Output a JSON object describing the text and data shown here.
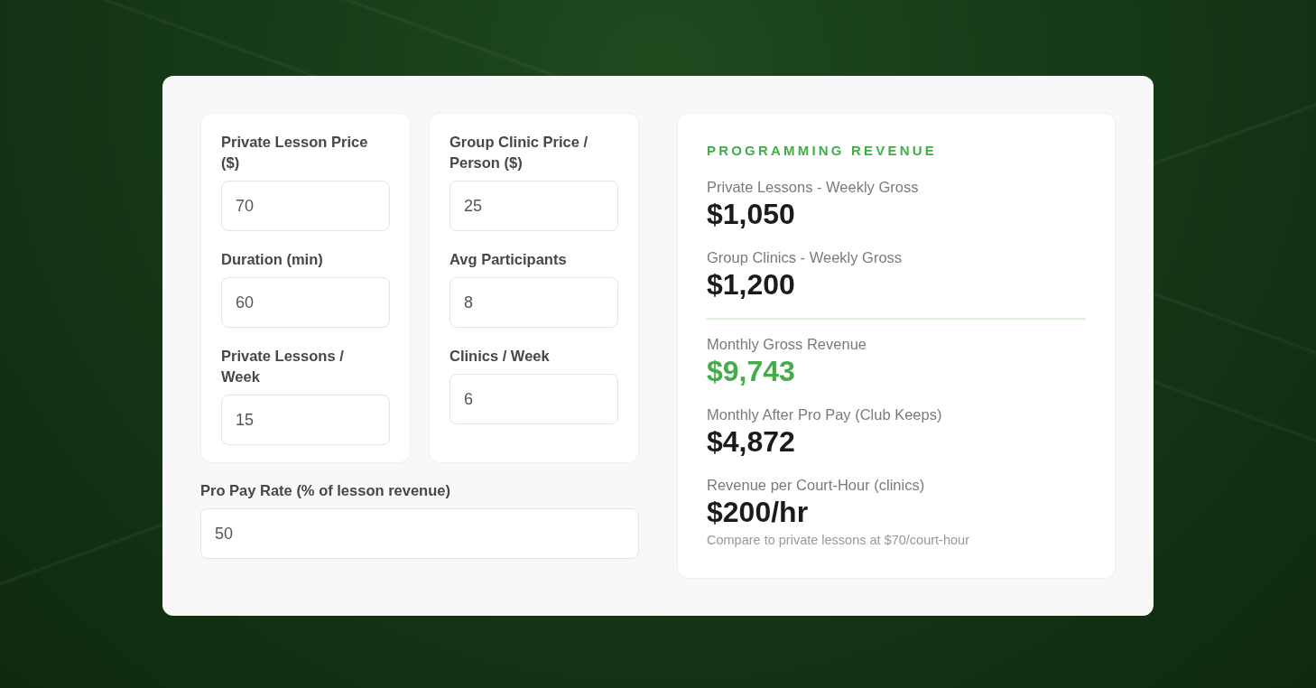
{
  "calculator": {
    "input_panels": [
      {
        "fields": [
          {
            "label": "Private Lesson Price ($)",
            "value": "70"
          },
          {
            "label": "Duration (min)",
            "value": "60"
          },
          {
            "label": "Private Lessons / Week",
            "value": "15"
          }
        ]
      },
      {
        "fields": [
          {
            "label": "Group Clinic Price / Person ($)",
            "value": "25"
          },
          {
            "label": "Avg Participants",
            "value": "8"
          },
          {
            "label": "Clinics / Week",
            "value": "6"
          }
        ]
      }
    ],
    "pro_pay_rate": {
      "label": "Pro Pay Rate (% of lesson revenue)",
      "value": "50"
    },
    "results": {
      "title": "PROGRAMMING REVENUE",
      "sections": [
        {
          "items": [
            {
              "label": "Private Lessons - Weekly Gross",
              "value": "$1,050",
              "highlighted": false
            },
            {
              "label": "Group Clinics - Weekly Gross",
              "value": "$1,200",
              "highlighted": false
            }
          ]
        },
        {
          "items": [
            {
              "label": "Monthly Gross Revenue",
              "value": "$9,743",
              "highlighted": true
            },
            {
              "label": "Monthly After Pro Pay (Club Keeps)",
              "value": "$4,872",
              "highlighted": false
            },
            {
              "label": "Revenue per Court-Hour (clinics)",
              "value": "$200/hr",
              "highlighted": false,
              "note": "Compare to private lessons at $70/court-hour"
            }
          ]
        }
      ]
    }
  }
}
